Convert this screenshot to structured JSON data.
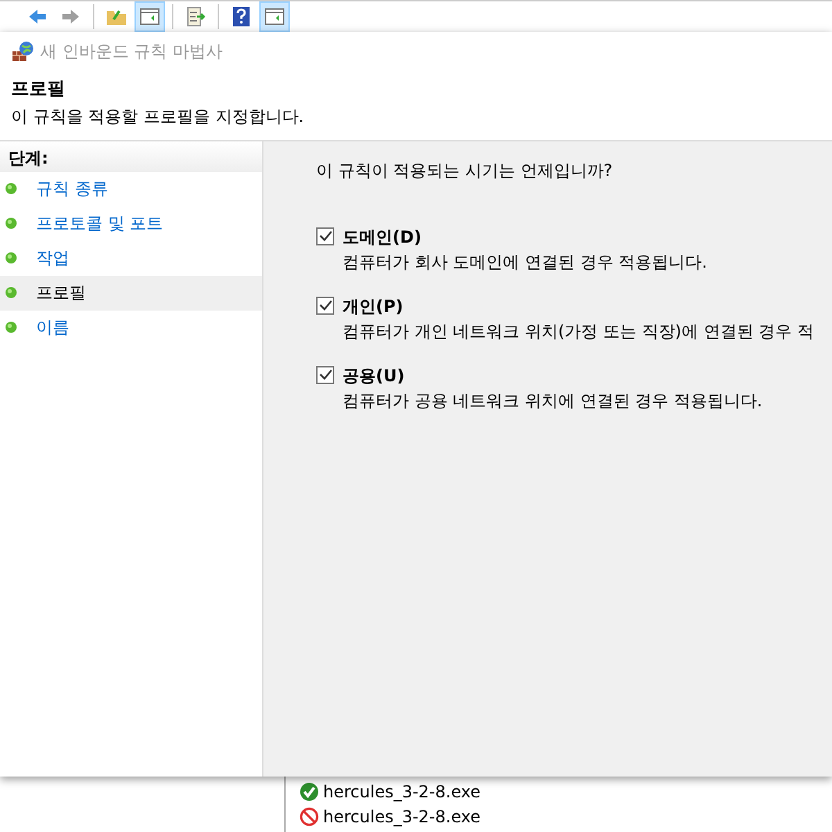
{
  "toolbar": {
    "buttons": [
      {
        "kind": "back",
        "disabled": false,
        "selected": false
      },
      {
        "kind": "forward",
        "disabled": true,
        "selected": false
      },
      {
        "kind": "folder",
        "disabled": false,
        "selected": false
      },
      {
        "kind": "panel",
        "disabled": false,
        "selected": true
      },
      {
        "kind": "export",
        "disabled": false,
        "selected": false
      },
      {
        "kind": "help",
        "disabled": false,
        "selected": false
      },
      {
        "kind": "panel",
        "disabled": false,
        "selected": true
      }
    ]
  },
  "window": {
    "title": "새 인바운드 규칙 마법사"
  },
  "header": {
    "title": "프로필",
    "subtitle": "이 규칙을 적용할 프로필을 지정합니다."
  },
  "steps": {
    "heading": "단계:",
    "items": [
      {
        "label": "규칙 종류",
        "selected": false
      },
      {
        "label": "프로토콜 및 포트",
        "selected": false
      },
      {
        "label": "작업",
        "selected": false
      },
      {
        "label": "프로필",
        "selected": true
      },
      {
        "label": "이름",
        "selected": false
      }
    ]
  },
  "content": {
    "question": "이 규칙이 적용되는 시기는 언제입니까?",
    "options": [
      {
        "label": "도메인(D)",
        "description": "컴퓨터가 회사 도메인에 연결된 경우 적용됩니다.",
        "checked": true
      },
      {
        "label": "개인(P)",
        "description": "컴퓨터가 개인 네트워크 위치(가정 또는 직장)에 연결된 경우 적",
        "checked": true
      },
      {
        "label": "공용(U)",
        "description": "컴퓨터가 공용 네트워크 위치에 연결된 경우 적용됩니다.",
        "checked": true
      }
    ]
  },
  "background_list": {
    "rows": [
      {
        "name": "hercules_3-2-8.exe",
        "kind": "allowed"
      },
      {
        "name": "hercules_3-2-8.exe",
        "kind": "blocked"
      }
    ]
  }
}
